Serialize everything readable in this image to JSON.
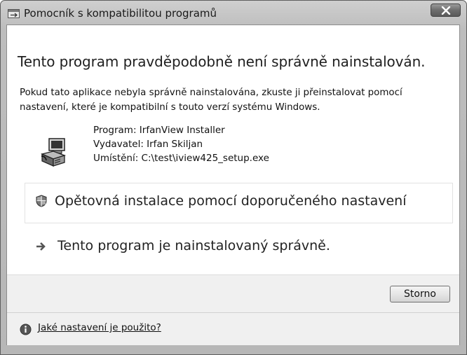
{
  "window": {
    "title": "Pomocník s kompatibilitou programů",
    "close_icon": "close-x-icon",
    "app_icon": "compatibility-wizard-icon"
  },
  "main": {
    "heading": "Tento program pravděpodobně není správně nainstalován.",
    "description": "Pokud tato aplikace nebyla správně nainstalována, zkuste ji přeinstalovat pomocí nastavení, které je kompatibilní s touto verzí systému Windows.",
    "program_icon": "installer-icon",
    "program_line": "Program: IrfanView Installer",
    "publisher_line": "Vydavatel: Irfan Skiljan",
    "location_line": "Umístění: C:\\test\\iview425_setup.exe"
  },
  "options": [
    {
      "icon": "shield-icon",
      "label": "Opětovná instalace pomocí doporučeného nastavení"
    },
    {
      "icon": "arrow-right-icon",
      "label": "Tento program je nainstalovaný správně."
    }
  ],
  "buttons": {
    "cancel": "Storno"
  },
  "footer": {
    "icon": "info-icon",
    "link": "Jaké nastavení je použito?"
  }
}
